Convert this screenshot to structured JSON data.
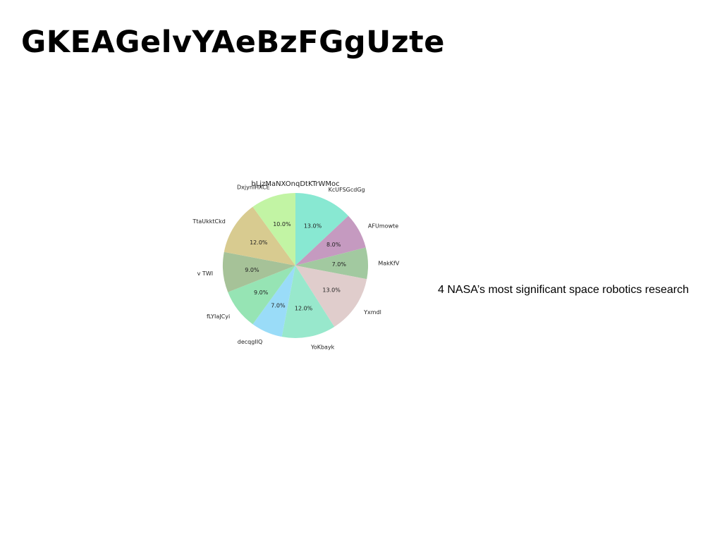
{
  "page": {
    "title": "GKEAGelvYAeBzFGgUzte",
    "caption": "4 NASA’s most significant space robotics research"
  },
  "chart_data": {
    "type": "pie",
    "title": "bLjzMaNXOnqDtKTrWMoc",
    "start_angle_deg": 90,
    "direction": "clockwise",
    "slices": [
      {
        "label": "KcUFSGcdGg",
        "value": 13.0,
        "pct_label": "13.0%",
        "color": "#88e8d2"
      },
      {
        "label": "AFUmowte",
        "value": 8.0,
        "pct_label": "8.0%",
        "color": "#c59ac0"
      },
      {
        "label": "MakKfV",
        "value": 7.0,
        "pct_label": "7.0%",
        "color": "#a2c9a0"
      },
      {
        "label": "Yxmdl",
        "value": 13.0,
        "pct_label": "13.0%",
        "color": "#e0cdcc"
      },
      {
        "label": "YoKbayk",
        "value": 12.0,
        "pct_label": "12.0%",
        "color": "#98e8cc"
      },
      {
        "label": "decqgIIQ",
        "value": 7.0,
        "pct_label": "7.0%",
        "color": "#9adcf8"
      },
      {
        "label": "fLYIaJCyi",
        "value": 9.0,
        "pct_label": "9.0%",
        "color": "#96e4b4"
      },
      {
        "label": "v TWI",
        "value": 9.0,
        "pct_label": "9.0%",
        "color": "#a6c298"
      },
      {
        "label": "TtaUkktCkd",
        "value": 12.0,
        "pct_label": "12.0%",
        "color": "#d8cb90"
      },
      {
        "label": "DxjyniHXCE",
        "value": 10.0,
        "pct_label": "10.0%",
        "color": "#c2f4a4"
      }
    ]
  }
}
